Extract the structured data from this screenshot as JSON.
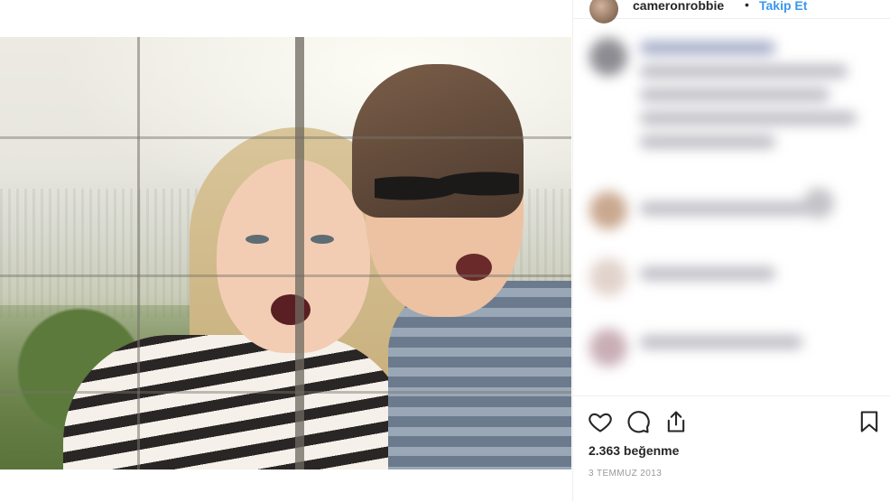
{
  "post": {
    "username": "cameronrobbie",
    "separator": "•",
    "follow_label": "Takip Et",
    "likes_text": "2.363 beğenme",
    "date_text": "3 TEMMUZ 2013"
  },
  "icons": {
    "like": "heart-icon",
    "comment": "comment-icon",
    "share": "share-icon",
    "save": "bookmark-icon"
  },
  "colors": {
    "link_blue": "#3897f0",
    "text_dark": "#262626",
    "muted": "#999999",
    "divider": "#efefef"
  }
}
